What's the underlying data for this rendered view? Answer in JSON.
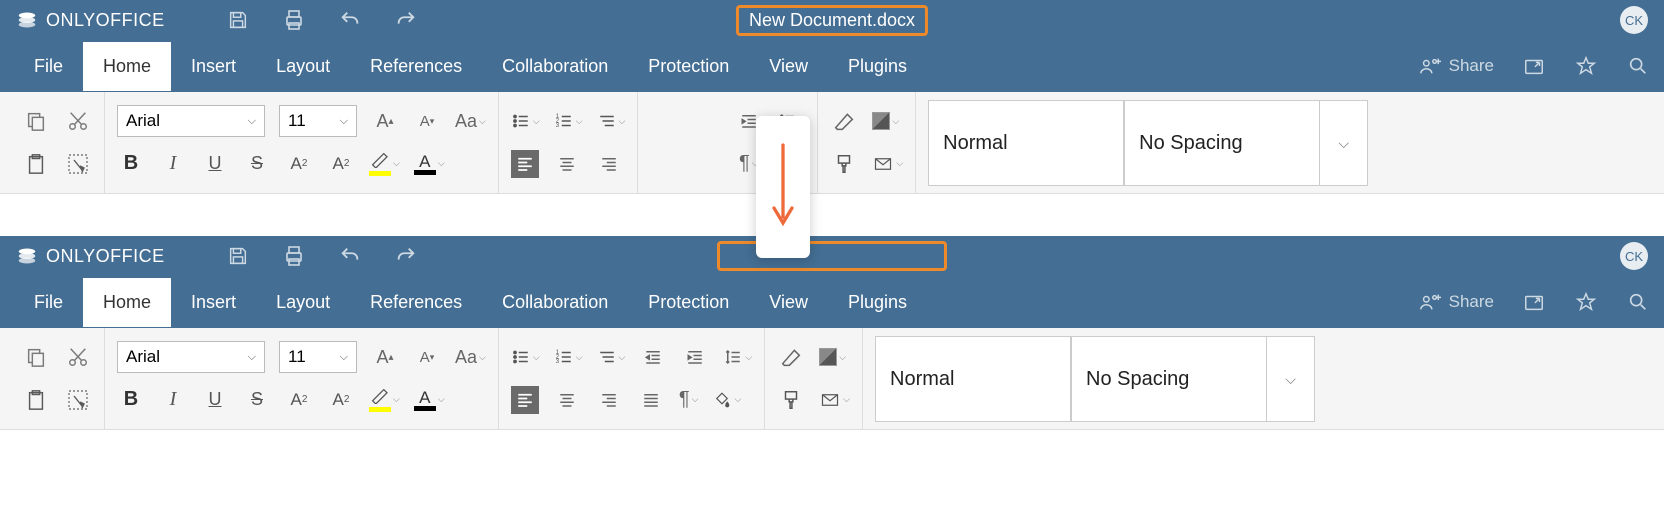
{
  "app_name": "ONLYOFFICE",
  "doc_title_1": "New Document.docx",
  "doc_title_2": "",
  "avatar": "CK",
  "menu": {
    "file": "File",
    "home": "Home",
    "insert": "Insert",
    "layout": "Layout",
    "references": "References",
    "collaboration": "Collaboration",
    "protection": "Protection",
    "view": "View",
    "plugins": "Plugins"
  },
  "share": "Share",
  "font": {
    "name": "Arial",
    "size": "11"
  },
  "typo": {
    "bold": "B",
    "italic": "I",
    "underline": "U",
    "strike": "S",
    "super": "A",
    "sub": "A"
  },
  "styles": {
    "normal": "Normal",
    "nospacing": "No Spacing"
  }
}
